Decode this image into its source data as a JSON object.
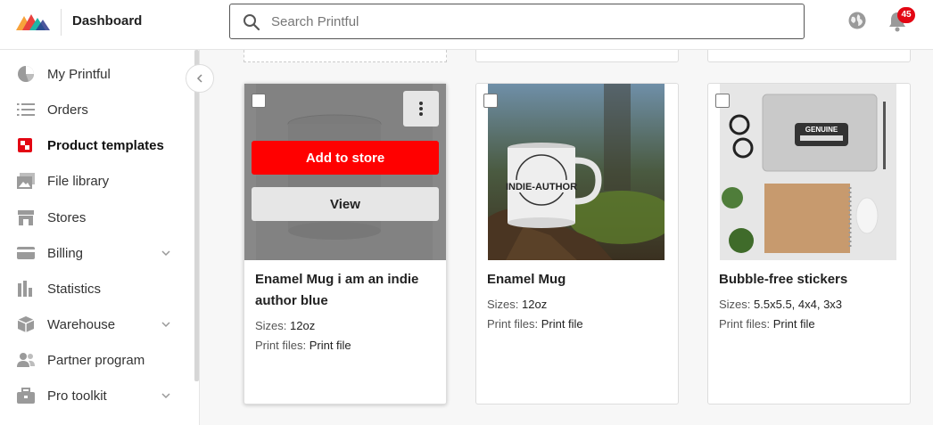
{
  "header": {
    "brand": "Dashboard",
    "search_placeholder": "Search Printful",
    "notifications_count": "45"
  },
  "sidebar": {
    "items": [
      {
        "label": "My Printful",
        "icon": "pie-chart-icon",
        "has_submenu": false
      },
      {
        "label": "Orders",
        "icon": "list-icon",
        "has_submenu": false
      },
      {
        "label": "Product templates",
        "icon": "templates-icon",
        "has_submenu": false,
        "active": true
      },
      {
        "label": "File library",
        "icon": "images-icon",
        "has_submenu": false
      },
      {
        "label": "Stores",
        "icon": "store-icon",
        "has_submenu": false
      },
      {
        "label": "Billing",
        "icon": "card-icon",
        "has_submenu": true
      },
      {
        "label": "Statistics",
        "icon": "bar-chart-icon",
        "has_submenu": false
      },
      {
        "label": "Warehouse",
        "icon": "box-icon",
        "has_submenu": true
      },
      {
        "label": "Partner program",
        "icon": "people-icon",
        "has_submenu": false
      },
      {
        "label": "Pro toolkit",
        "icon": "briefcase-icon",
        "has_submenu": true
      }
    ]
  },
  "products": [
    {
      "title": "Enamel Mug i am an indie author blue",
      "sizes_label": "Sizes:",
      "sizes": "12oz",
      "files_label": "Print files:",
      "files": "Print file",
      "hovered": true,
      "add_label": "Add to store",
      "view_label": "View"
    },
    {
      "title": "Enamel Mug",
      "sizes_label": "Sizes:",
      "sizes": "12oz",
      "files_label": "Print files:",
      "files": "Print file",
      "mug_text": "INDIE-AUTHOR"
    },
    {
      "title": "Bubble-free stickers",
      "sizes_label": "Sizes:",
      "sizes": "5.5x5.5, 4x4, 3x3",
      "files_label": "Print files:",
      "files": "Print file",
      "sticker_text": "GENUINE"
    }
  ],
  "colors": {
    "accent_red": "#ff0000",
    "badge_red": "#e30613",
    "active_icon": "#e30613"
  }
}
